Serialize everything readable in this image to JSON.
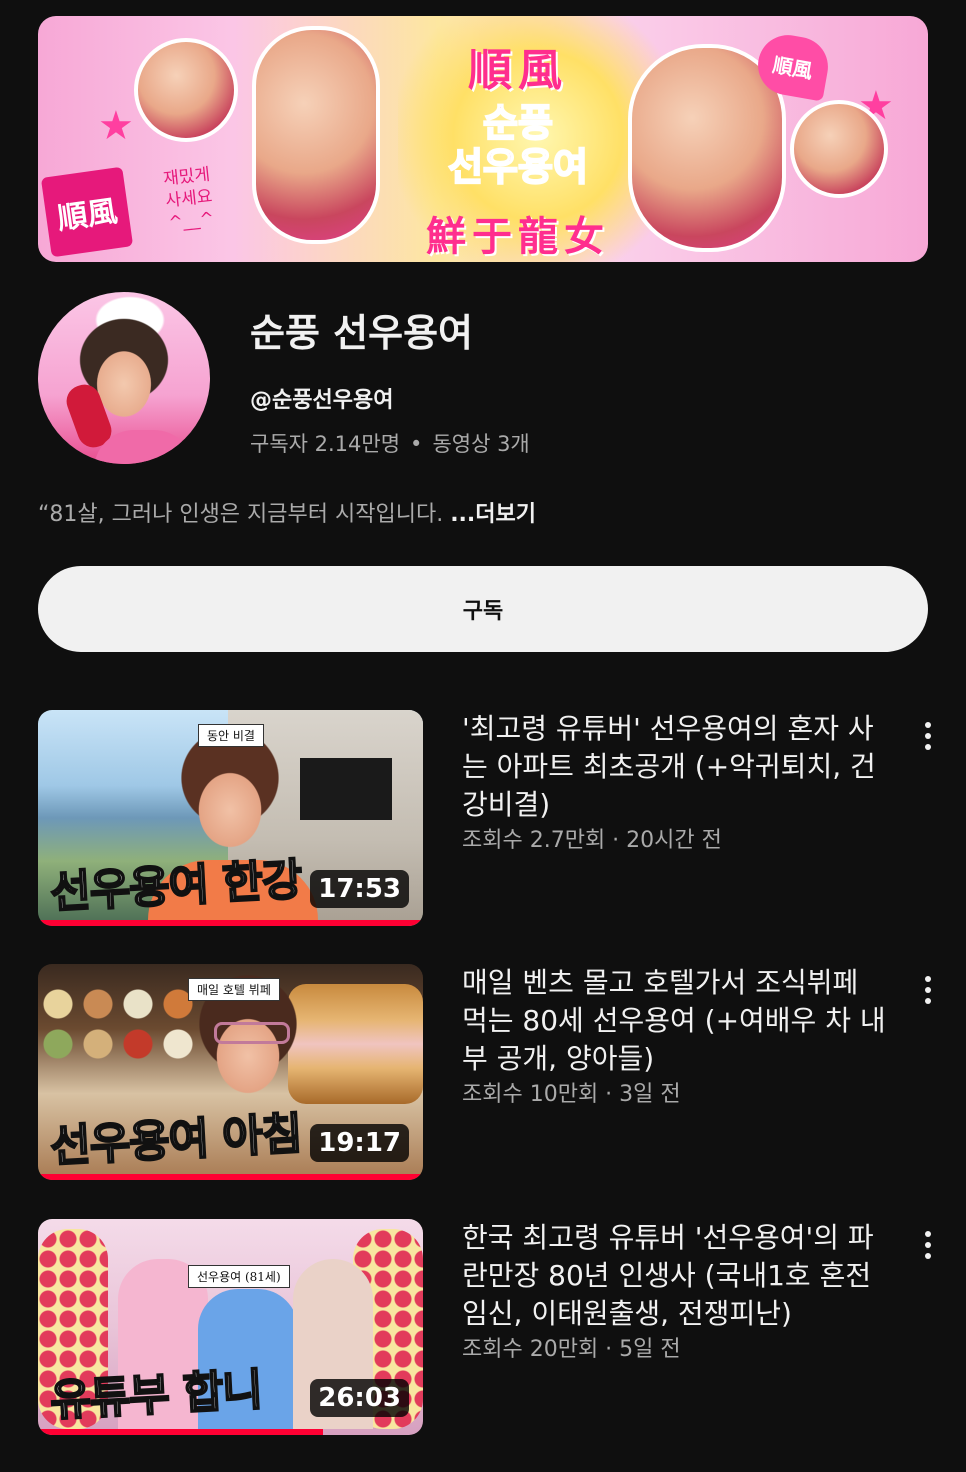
{
  "banner": {
    "title_hanja": "順風",
    "title_hangul": "순풍\n선우용여",
    "bottom_hanja": "鮮于龍女",
    "stamp": "順風",
    "tagline": "재밌게\n사세요\n^__^",
    "heart_label": "順風"
  },
  "channel": {
    "name": "순풍 선우용여",
    "handle": "@순풍선우용여",
    "subscribers": "구독자 2.14만명",
    "separator": "•",
    "videos_count": "동영상 3개",
    "description": "“81살, 그러나 인생은 지금부터 시작입니다. ",
    "more_label": "...더보기",
    "subscribe_label": "구독"
  },
  "videos": [
    {
      "title": "'최고령 유튜버' 선우용여의 혼자 사는 아파트 최초공개 (+악귀퇴치, 건강비결)",
      "meta": "조회수 2.7만회 · 20시간 전",
      "duration": "17:53",
      "thumb_tag": "동안 비결",
      "thumb_caption": "선우용여 한강"
    },
    {
      "title": "매일 벤츠 몰고 호텔가서 조식뷔페 먹는 80세 선우용여 (+여배우 차 내부 공개, 양아들)",
      "meta": "조회수 10만회 · 3일 전",
      "duration": "19:17",
      "thumb_tag": "매일 호텔 뷔페",
      "thumb_caption": "선우용여 아침"
    },
    {
      "title": "한국 최고령 유튜버 '선우용여'의 파란만장 80년 인생사 (국내1호 혼전임신, 이태원출생, 전쟁피난)",
      "meta": "조회수 20만회 · 5일 전",
      "duration": "26:03",
      "thumb_tag": "선우용여 (81세)",
      "thumb_caption": "유튜부 합니",
      "watched_fraction": 0.74
    }
  ],
  "colors": {
    "background": "#0f0f0f",
    "text_primary": "#f1f1f1",
    "text_secondary": "#aaaaaa",
    "progress": "#ff0033",
    "accent_pink": "#ff3fa0"
  }
}
